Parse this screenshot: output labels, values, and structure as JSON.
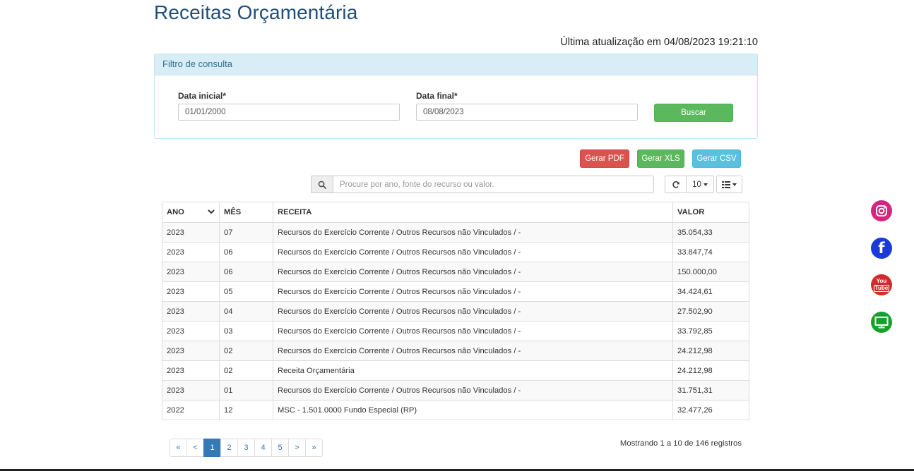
{
  "page": {
    "title": "Receitas Orçamentária",
    "last_update": "Última atualização em 04/08/2023 19:21:10"
  },
  "filter": {
    "heading": "Filtro de consulta",
    "start_label": "Data inicial*",
    "start_value": "01/01/2000",
    "end_label": "Data final*",
    "end_value": "08/08/2023",
    "search_button": "Buscar"
  },
  "exports": {
    "pdf": "Gerar PDF",
    "xls": "Gerar XLS",
    "csv": "Gerar CSV"
  },
  "toolbar": {
    "search_placeholder": "Procure por ano, fonte do recurso ou valor.",
    "page_size": "10",
    "icons": {
      "search": "search-icon",
      "refresh": "refresh-icon",
      "columns": "columns-list-icon",
      "sort": "chevron-down-icon"
    }
  },
  "table": {
    "headers": [
      "ANO",
      "MÊS",
      "RECEITA",
      "VALOR"
    ],
    "rows": [
      [
        "2023",
        "07",
        "Recursos do Exercício Corrente / Outros Recursos não Vinculados / -",
        "35.054,33"
      ],
      [
        "2023",
        "06",
        "Recursos do Exercício Corrente / Outros Recursos não Vinculados / -",
        "33.847,74"
      ],
      [
        "2023",
        "06",
        "Recursos do Exercício Corrente / Outros Recursos não Vinculados / -",
        "150.000,00"
      ],
      [
        "2023",
        "05",
        "Recursos do Exercício Corrente / Outros Recursos não Vinculados / -",
        "34.424,61"
      ],
      [
        "2023",
        "04",
        "Recursos do Exercício Corrente / Outros Recursos não Vinculados / -",
        "27.502,90"
      ],
      [
        "2023",
        "03",
        "Recursos do Exercício Corrente / Outros Recursos não Vinculados / -",
        "33.792,85"
      ],
      [
        "2023",
        "02",
        "Recursos do Exercício Corrente / Outros Recursos não Vinculados / -",
        "24.212,98"
      ],
      [
        "2023",
        "02",
        "Receita Orçamentária",
        "24.212,98"
      ],
      [
        "2023",
        "01",
        "Recursos do Exercício Corrente / Outros Recursos não Vinculados / -",
        "31.751,31"
      ],
      [
        "2022",
        "12",
        "MSC - 1.501.0000 Fundo Especial (RP)",
        "32.477,26"
      ]
    ]
  },
  "pagination": {
    "first": "«",
    "prev": "<",
    "pages": [
      "1",
      "2",
      "3",
      "4",
      "5"
    ],
    "active_page": "1",
    "next": ">",
    "last": "»",
    "summary": "Mostrando 1 a 10 de 146 registros"
  },
  "social": {
    "icons": [
      "instagram-icon",
      "facebook-icon",
      "youtube-icon",
      "monitor-icon"
    ],
    "youtube_text": [
      "You",
      "Tube"
    ],
    "facebook_letter": "f",
    "colors": {
      "instagram": "#d6247f",
      "facebook": "#1a3bd6",
      "youtube": "#d12b2b",
      "monitor": "#15a12a"
    }
  }
}
